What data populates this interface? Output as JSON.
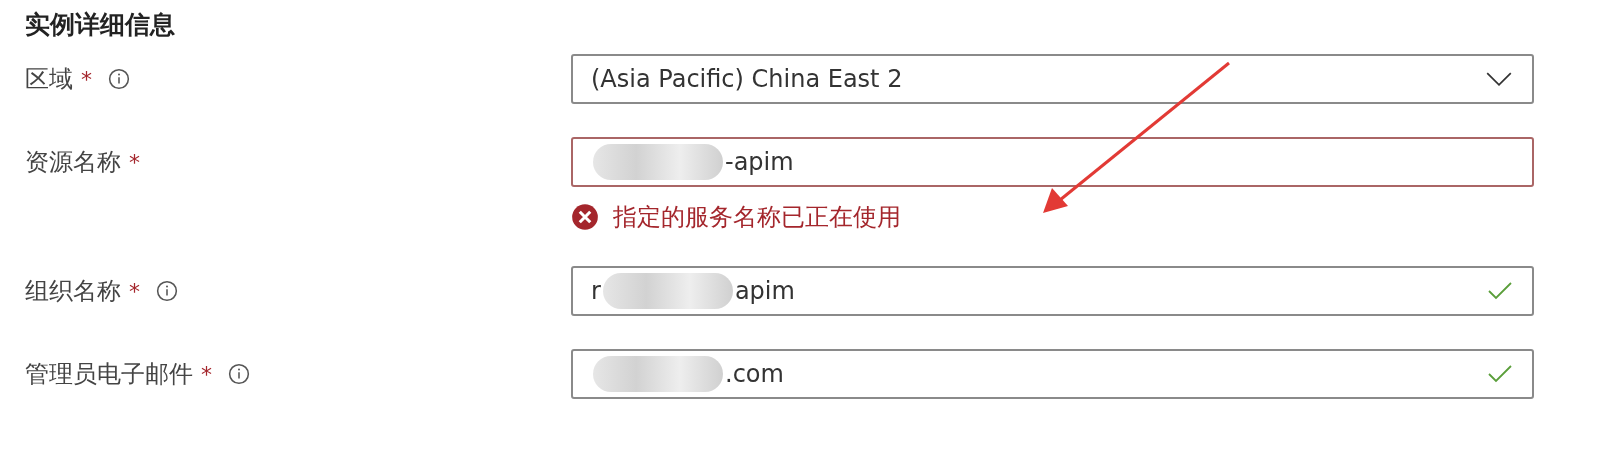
{
  "section": {
    "title": "实例详细信息"
  },
  "fields": [
    {
      "label": "区域",
      "required_mark": "*",
      "info": true,
      "kind": "dropdown",
      "valid": false,
      "invalid": false,
      "segments": [
        {
          "kind": "text",
          "text": "(Asia Pacific) China East 2"
        }
      ]
    },
    {
      "label": "资源名称",
      "required_mark": "*",
      "info": false,
      "kind": "text",
      "valid": false,
      "invalid": true,
      "error": "指定的服务名称已正在使用",
      "segments": [
        {
          "kind": "redacted"
        },
        {
          "kind": "text",
          "text": "-apim"
        }
      ]
    },
    {
      "label": "组织名称",
      "required_mark": "*",
      "info": true,
      "kind": "text",
      "valid": true,
      "invalid": false,
      "segments": [
        {
          "kind": "text",
          "text": "r"
        },
        {
          "kind": "redacted"
        },
        {
          "kind": "text",
          "text": "apim"
        }
      ]
    },
    {
      "label": "管理员电子邮件",
      "required_mark": "*",
      "info": true,
      "kind": "text",
      "valid": true,
      "invalid": false,
      "segments": [
        {
          "kind": "redacted"
        },
        {
          "kind": "text",
          "text": ".com"
        }
      ]
    }
  ],
  "annotation": {
    "kind": "arrow"
  }
}
